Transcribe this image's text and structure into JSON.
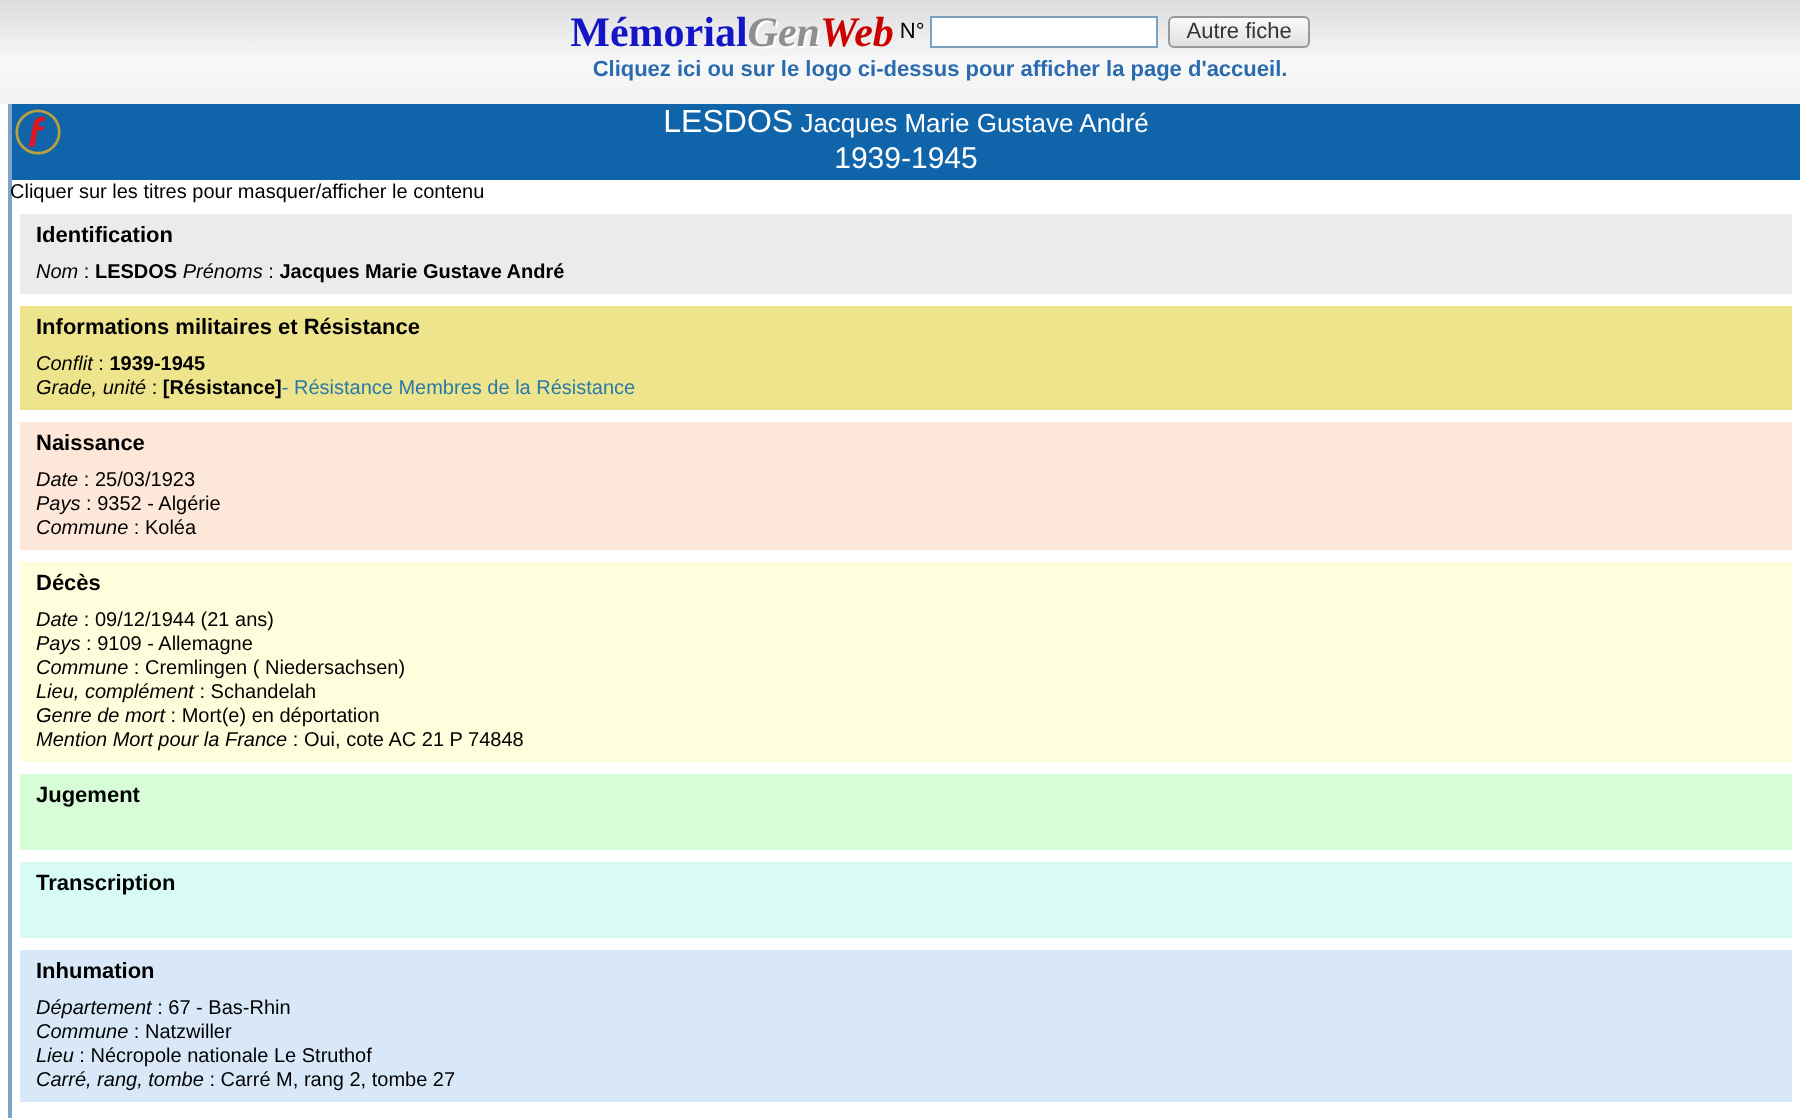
{
  "header": {
    "logo": [
      "Mémorial",
      "Gen",
      "Web"
    ],
    "number_label": "N°",
    "button": "Autre fiche",
    "home_link": "Cliquez ici ou sur le logo ci-dessus pour afficher la page d'accueil."
  },
  "banner": {
    "surname": "LESDOS",
    "given_names": "Jacques Marie Gustave André",
    "period": "1939-1945"
  },
  "hint": "Cliquer sur les titres pour masquer/afficher le contenu",
  "sections": [
    {
      "title": "Identification",
      "color": "#ebebeb",
      "lines": [
        {
          "text": "*Nom* : **LESDOS** *Prénoms* : **Jacques Marie Gustave André**"
        }
      ]
    },
    {
      "title": "Informations militaires et Résistance",
      "color": "#ede48c",
      "lines": [
        {
          "text": "*Conflit* : **1939-1945**"
        },
        {
          "text": "*Grade, unité* : **[Résistance]**",
          "link": "- Résistance Membres de la Résistance"
        }
      ]
    },
    {
      "title": "Naissance",
      "color": "#fde7d8",
      "lines": [
        {
          "text": "*Date* : 25/03/1923"
        },
        {
          "text": "*Pays* : 9352 - Algérie"
        },
        {
          "text": "*Commune* : Koléa"
        }
      ]
    },
    {
      "title": "Décès",
      "color": "#fefedd",
      "lines": [
        {
          "text": "*Date* : 09/12/1944  (21 ans)"
        },
        {
          "text": "*Pays* : 9109 - Allemagne"
        },
        {
          "text": "*Commune* : Cremlingen ( Niedersachsen)"
        },
        {
          "text": "*Lieu, complément* : Schandelah"
        },
        {
          "text": "*Genre de mort* : Mort(e) en déportation"
        },
        {
          "text": "*Mention Mort pour la France* : Oui, cote AC 21 P 74848"
        }
      ]
    },
    {
      "title": "Jugement",
      "color": "#d7fdd7"
    },
    {
      "title": "Transcription",
      "color": "#d8fcf5"
    },
    {
      "title": "Inhumation",
      "color": "#d8e8f8",
      "lines": [
        {
          "text": "*Département* : 67 - Bas-Rhin"
        },
        {
          "text": "*Commune* : Natzwiller"
        },
        {
          "text": "*Lieu* : Nécropole nationale Le Struthof"
        },
        {
          "text": "*Carré, rang, tombe* : Carré M, rang 2, tombe 27"
        }
      ]
    }
  ]
}
